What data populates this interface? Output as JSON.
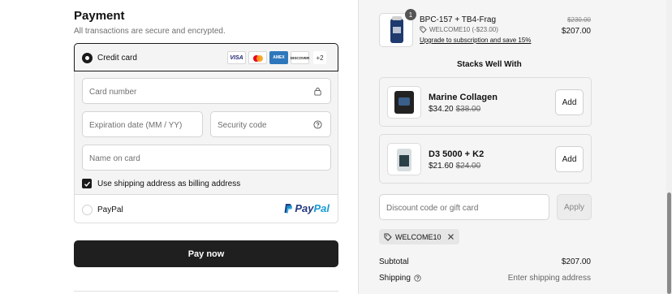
{
  "payment": {
    "title": "Payment",
    "subtitle": "All transactions are secure and encrypted.",
    "credit_card": {
      "label": "Credit card",
      "logos": {
        "visa": "VISA",
        "amex": "AMEX",
        "discover": "DISCOVER"
      },
      "more_logos": "+2",
      "card_number_placeholder": "Card number",
      "expiration_placeholder": "Expiration date (MM / YY)",
      "security_code_placeholder": "Security code",
      "name_placeholder": "Name on card",
      "billing_label": "Use shipping address as billing address",
      "billing_checked": true
    },
    "paypal": {
      "label": "PayPal",
      "logo_text_1": "Pay",
      "logo_text_2": "Pal"
    },
    "pay_button": "Pay now"
  },
  "order": {
    "item": {
      "quantity": "1",
      "name": "BPC-157 + TB4-Frag",
      "discount": "WELCOME10 (-$23.00)",
      "upgrade_link": "Upgrade to subscription and save 15%",
      "original_price": "$230.00",
      "price": "$207.00"
    },
    "stacks_title": "Stacks Well With",
    "recommendations": [
      {
        "name": "Marine Collagen",
        "price": "$34.20",
        "old_price": "$38.00",
        "add_label": "Add"
      },
      {
        "name": "D3 5000 + K2",
        "price": "$21.60",
        "old_price": "$24.00",
        "add_label": "Add"
      }
    ],
    "discount_placeholder": "Discount code or gift card",
    "apply_label": "Apply",
    "applied_code": "WELCOME10",
    "subtotal_label": "Subtotal",
    "subtotal_value": "$207.00",
    "shipping_label": "Shipping",
    "shipping_value": "Enter shipping address"
  },
  "colors": {
    "primary_button": "#1f1f1f",
    "sidebar_bg": "#f5f5f5",
    "paypal_dark": "#253b80",
    "paypal_light": "#179bd7"
  }
}
